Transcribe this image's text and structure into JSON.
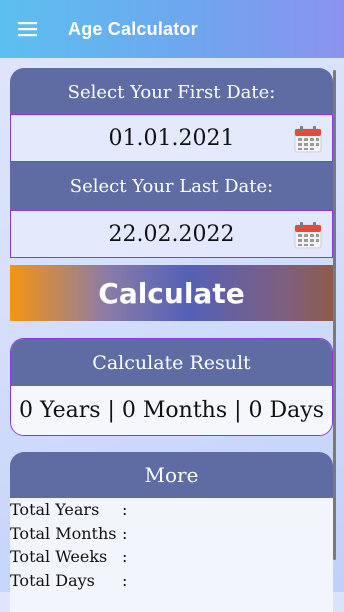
{
  "app_bar": {
    "title": "Age Calculator",
    "menu_icon": "hamburger-menu-icon"
  },
  "first_date": {
    "label": "Select Your First Date:",
    "value": "01.01.2021",
    "icon": "calendar-icon"
  },
  "last_date": {
    "label": "Select Your Last Date:",
    "value": "22.02.2022",
    "icon": "calendar-icon"
  },
  "calculate_button": {
    "label": "Calculate"
  },
  "result": {
    "header": "Calculate Result",
    "text": "0 Years | 0 Months | 0 Days"
  },
  "more": {
    "header": "More",
    "rows": [
      {
        "label": "Total Years",
        "sep": ":"
      },
      {
        "label": "Total Months",
        "sep": ":"
      },
      {
        "label": "Total Weeks",
        "sep": ":"
      },
      {
        "label": "Total Days",
        "sep": ":"
      }
    ]
  },
  "colors": {
    "header_bg": "#5f6ca4",
    "accent_border": "#8a3bd4",
    "appbar_start": "#5cc0ef",
    "appbar_end": "#8c93ef",
    "calculate_orange": "#f6940f"
  }
}
